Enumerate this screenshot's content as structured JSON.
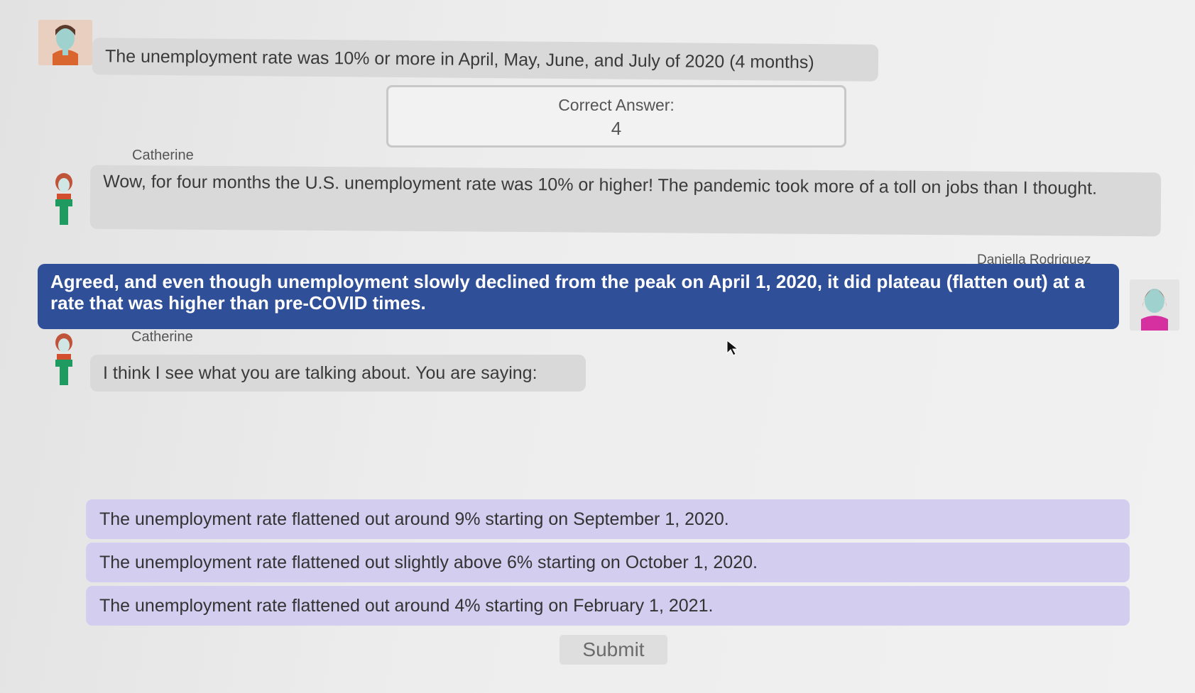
{
  "messages": {
    "intro": "The unemployment rate was 10% or more in April, May, June, and July of 2020 (4 months)",
    "correct_answer_label": "Correct Answer:",
    "correct_answer_value": "4",
    "catherine_1": {
      "speaker": "Catherine",
      "text": "Wow, for four months the U.S. unemployment rate was 10% or higher!  The pandemic took more of a toll on jobs than I thought."
    },
    "daniella": {
      "speaker": "Daniella Rodriguez",
      "text": "Agreed, and even though unemployment slowly declined from the peak on April 1, 2020, it did plateau (flatten out) at a rate that was higher than pre-COVID times."
    },
    "catherine_2": {
      "speaker": "Catherine",
      "text": "I think I see what you are talking about. You are saying:"
    }
  },
  "options": [
    "The unemployment rate flattened out around 9% starting on September 1, 2020.",
    "The unemployment rate flattened out slightly above 6% starting on October 1, 2020.",
    "The unemployment rate flattened out around 4% starting on February 1, 2021."
  ],
  "submit_label": "Submit",
  "colors": {
    "dark_bubble": "#2f4f98",
    "option_bg": "#d3cdf0",
    "bubble_bg": "#d9d9d9"
  }
}
